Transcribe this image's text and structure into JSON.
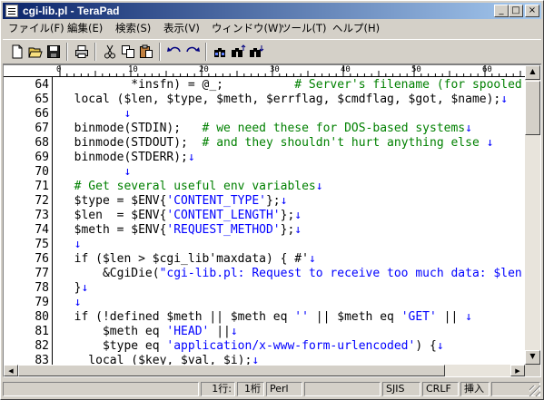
{
  "window": {
    "title": "cgi-lib.pl - TeraPad"
  },
  "caption_buttons": {
    "minimize": "_",
    "maximize": "□",
    "close": "×"
  },
  "menu": [
    "ファイル(F)",
    "編集(E)",
    "検索(S)",
    "表示(V)",
    "ウィンドウ(W)",
    "ツール(T)",
    "ヘルプ(H)"
  ],
  "toolbar": [
    "new-file-icon",
    "open-folder-icon",
    "save-icon",
    "print-icon",
    "cut-icon",
    "copy-icon",
    "paste-icon",
    "undo-icon",
    "redo-icon",
    "find-icon",
    "find-next-icon",
    "find-prev-icon"
  ],
  "ruler": [
    "0",
    "10",
    "20",
    "30",
    "40",
    "50",
    "60"
  ],
  "line_numbers": [
    "64",
    "65",
    "66",
    "67",
    "68",
    "69",
    "70",
    "71",
    "72",
    "73",
    "74",
    "75",
    "76",
    "77",
    "78",
    "79",
    "80",
    "81",
    "82",
    "83"
  ],
  "lines": [
    [
      {
        "t": "          *insfn) = @_;          ",
        "s": ""
      },
      {
        "t": "# Server's filename (for spooled",
        "s": "com"
      }
    ],
    [
      {
        "t": "  local ($len, $type, $meth, $errflag, $cmdflag, $got, $name);",
        "s": ""
      },
      {
        "t": "↓",
        "s": "ret"
      }
    ],
    [
      {
        "t": "         ",
        "s": ""
      },
      {
        "t": "↓",
        "s": "ret"
      }
    ],
    [
      {
        "t": "  binmode(STDIN);   ",
        "s": ""
      },
      {
        "t": "# we need these for DOS-based systems",
        "s": "com"
      },
      {
        "t": "↓",
        "s": "ret"
      }
    ],
    [
      {
        "t": "  binmode(STDOUT);  ",
        "s": ""
      },
      {
        "t": "# and they shouldn't hurt anything else ",
        "s": "com"
      },
      {
        "t": "↓",
        "s": "ret"
      }
    ],
    [
      {
        "t": "  binmode(STDERR);",
        "s": ""
      },
      {
        "t": "↓",
        "s": "ret"
      }
    ],
    [
      {
        "t": "         ",
        "s": ""
      },
      {
        "t": "↓",
        "s": "ret"
      }
    ],
    [
      {
        "t": "  ",
        "s": ""
      },
      {
        "t": "# Get several useful env variables",
        "s": "com"
      },
      {
        "t": "↓",
        "s": "ret"
      }
    ],
    [
      {
        "t": "  $type = $ENV{",
        "s": ""
      },
      {
        "t": "'CONTENT_TYPE'",
        "s": "str"
      },
      {
        "t": "};",
        "s": ""
      },
      {
        "t": "↓",
        "s": "ret"
      }
    ],
    [
      {
        "t": "  $len  = $ENV{",
        "s": ""
      },
      {
        "t": "'CONTENT_LENGTH'",
        "s": "str"
      },
      {
        "t": "};",
        "s": ""
      },
      {
        "t": "↓",
        "s": "ret"
      }
    ],
    [
      {
        "t": "  $meth = $ENV{",
        "s": ""
      },
      {
        "t": "'REQUEST_METHOD'",
        "s": "str"
      },
      {
        "t": "};",
        "s": ""
      },
      {
        "t": "↓",
        "s": "ret"
      }
    ],
    [
      {
        "t": "  ",
        "s": ""
      },
      {
        "t": "↓",
        "s": "ret"
      }
    ],
    [
      {
        "t": "  if ($len > $cgi_lib'maxdata) { #'",
        "s": ""
      },
      {
        "t": "↓",
        "s": "ret"
      }
    ],
    [
      {
        "t": "      &CgiDie(",
        "s": ""
      },
      {
        "t": "\"cgi-lib.pl: Request to receive too much data: $len",
        "s": "str"
      }
    ],
    [
      {
        "t": "  }",
        "s": ""
      },
      {
        "t": "↓",
        "s": "ret"
      }
    ],
    [
      {
        "t": "  ",
        "s": ""
      },
      {
        "t": "↓",
        "s": "ret"
      }
    ],
    [
      {
        "t": "  if (!defined $meth || $meth eq ",
        "s": ""
      },
      {
        "t": "''",
        "s": "str"
      },
      {
        "t": " || $meth eq ",
        "s": ""
      },
      {
        "t": "'GET'",
        "s": "str"
      },
      {
        "t": " || ",
        "s": ""
      },
      {
        "t": "↓",
        "s": "ret"
      }
    ],
    [
      {
        "t": "      $meth eq ",
        "s": ""
      },
      {
        "t": "'HEAD'",
        "s": "str"
      },
      {
        "t": " ||",
        "s": ""
      },
      {
        "t": "↓",
        "s": "ret"
      }
    ],
    [
      {
        "t": "      $type eq ",
        "s": ""
      },
      {
        "t": "'application/x-www-form-urlencoded'",
        "s": "str"
      },
      {
        "t": ") {",
        "s": ""
      },
      {
        "t": "↓",
        "s": "ret"
      }
    ],
    [
      {
        "t": "    local ($key, $val, $i);",
        "s": ""
      },
      {
        "t": "↓",
        "s": "ret"
      }
    ]
  ],
  "status": {
    "line": "1行:",
    "col": "1桁",
    "mode": "Perl",
    "encoding": "SJIS",
    "newline": "CRLF",
    "insert": "挿入"
  },
  "colors": {
    "comment": "#008000",
    "string": "#0000ff",
    "linebreak": "#0000ff",
    "title_start": "#0a246a",
    "title_end": "#a6caf0"
  }
}
